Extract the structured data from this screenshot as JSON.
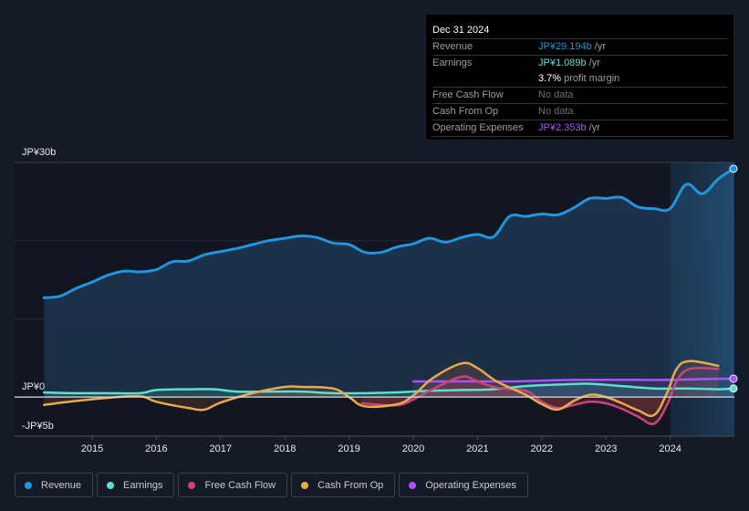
{
  "tooltip": {
    "date": "Dec 31 2024",
    "rows": [
      {
        "label": "Revenue",
        "value": "JP¥29.194b",
        "suffix": " /yr",
        "color": "#2394df"
      },
      {
        "label": "Earnings",
        "value": "JP¥1.089b",
        "suffix": " /yr",
        "color": "#5fe0cf"
      },
      {
        "label": "",
        "value": "3.7%",
        "suffix": " profit margin",
        "color": "#ffffff"
      },
      {
        "label": "Free Cash Flow",
        "value": "No data",
        "suffix": "",
        "color": "#6b6f76"
      },
      {
        "label": "Cash From Op",
        "value": "No data",
        "suffix": "",
        "color": "#6b6f76"
      },
      {
        "label": "Operating Expenses",
        "value": "JP¥2.353b",
        "suffix": " /yr",
        "color": "#a855f7"
      }
    ]
  },
  "legend": [
    {
      "label": "Revenue",
      "color": "#2394df"
    },
    {
      "label": "Earnings",
      "color": "#5fe0cf"
    },
    {
      "label": "Free Cash Flow",
      "color": "#c9457f"
    },
    {
      "label": "Cash From Op",
      "color": "#e9a94f"
    },
    {
      "label": "Operating Expenses",
      "color": "#a855f7"
    }
  ],
  "chart_data": {
    "type": "line",
    "title": "",
    "xlabel": "",
    "ylabel": "",
    "ylim": [
      -5,
      30
    ],
    "xlim": [
      2014.2,
      2024.99
    ],
    "y_tick_labels": [
      {
        "value": 30,
        "label": "JP¥30b"
      },
      {
        "value": 0,
        "label": "JP¥0"
      },
      {
        "value": -5,
        "label": "-JP¥5b"
      }
    ],
    "gridlines": [
      30,
      20,
      10,
      0
    ],
    "x_tick_labels": [
      "2015",
      "2016",
      "2017",
      "2018",
      "2019",
      "2020",
      "2021",
      "2022",
      "2023",
      "2024"
    ],
    "highlight_from": 2024.0,
    "units": "JPY billions",
    "series": [
      {
        "name": "Revenue",
        "color": "#2394df",
        "fill": true,
        "x": [
          2014.25,
          2014.5,
          2014.75,
          2015.0,
          2015.25,
          2015.5,
          2015.75,
          2016.0,
          2016.25,
          2016.5,
          2016.75,
          2017.0,
          2017.25,
          2017.5,
          2017.75,
          2018.0,
          2018.25,
          2018.5,
          2018.75,
          2019.0,
          2019.25,
          2019.5,
          2019.75,
          2020.0,
          2020.25,
          2020.5,
          2020.75,
          2021.0,
          2021.25,
          2021.5,
          2021.75,
          2022.0,
          2022.25,
          2022.5,
          2022.75,
          2023.0,
          2023.25,
          2023.5,
          2023.75,
          2024.0,
          2024.25,
          2024.5,
          2024.75,
          2024.99
        ],
        "values": [
          12.7,
          12.9,
          13.9,
          14.7,
          15.6,
          16.1,
          16.0,
          16.3,
          17.3,
          17.4,
          18.2,
          18.6,
          19.0,
          19.5,
          20.0,
          20.3,
          20.6,
          20.4,
          19.7,
          19.5,
          18.5,
          18.5,
          19.2,
          19.6,
          20.3,
          19.8,
          20.4,
          20.8,
          20.5,
          23.1,
          23.1,
          23.4,
          23.3,
          24.2,
          25.4,
          25.4,
          25.5,
          24.3,
          24.1,
          24.1,
          27.2,
          26.0,
          27.9,
          29.19
        ]
      },
      {
        "name": "Earnings",
        "color": "#5fe0cf",
        "fill": true,
        "x": [
          2014.25,
          2014.75,
          2015.25,
          2015.75,
          2016.0,
          2016.5,
          2016.9,
          2017.25,
          2017.75,
          2018.25,
          2018.75,
          2019.25,
          2019.75,
          2020.25,
          2020.75,
          2021.25,
          2021.75,
          2022.25,
          2022.75,
          2023.25,
          2023.75,
          2024.25,
          2024.75,
          2024.99
        ],
        "values": [
          0.6,
          0.5,
          0.5,
          0.5,
          0.9,
          1.0,
          1.0,
          0.7,
          0.7,
          0.7,
          0.5,
          0.5,
          0.6,
          0.8,
          0.9,
          1.0,
          1.4,
          1.6,
          1.7,
          1.4,
          1.1,
          1.1,
          1.0,
          1.09
        ]
      },
      {
        "name": "Free Cash Flow",
        "color": "#c9457f",
        "fill": true,
        "x": [
          2019.2,
          2019.5,
          2019.8,
          2020.0,
          2020.3,
          2020.75,
          2021.0,
          2021.3,
          2021.75,
          2022.0,
          2022.25,
          2022.5,
          2022.75,
          2023.0,
          2023.25,
          2023.5,
          2023.75,
          2023.95,
          2024.1,
          2024.3,
          2024.75
        ],
        "values": [
          -0.8,
          -1.0,
          -1.0,
          -0.3,
          1.0,
          2.6,
          2.0,
          1.2,
          0.8,
          -0.6,
          -1.4,
          -1.0,
          -0.6,
          -0.8,
          -1.5,
          -2.5,
          -3.4,
          -1.0,
          2.0,
          3.6,
          3.6
        ]
      },
      {
        "name": "Cash From Op",
        "color": "#e9a94f",
        "fill": true,
        "x": [
          2014.25,
          2014.75,
          2015.25,
          2015.75,
          2016.0,
          2016.5,
          2016.75,
          2017.0,
          2017.5,
          2018.0,
          2018.25,
          2018.75,
          2019.0,
          2019.25,
          2019.75,
          2020.0,
          2020.3,
          2020.75,
          2021.0,
          2021.3,
          2021.75,
          2022.0,
          2022.25,
          2022.5,
          2022.75,
          2023.0,
          2023.25,
          2023.5,
          2023.75,
          2023.95,
          2024.1,
          2024.3,
          2024.75
        ],
        "values": [
          -1.0,
          -0.5,
          -0.1,
          0.1,
          -0.6,
          -1.4,
          -1.6,
          -0.7,
          0.5,
          1.3,
          1.3,
          1.1,
          0.0,
          -1.2,
          -0.9,
          0.2,
          2.4,
          4.3,
          3.7,
          2.0,
          0.3,
          -0.9,
          -1.6,
          -0.5,
          0.3,
          0.0,
          -0.8,
          -1.7,
          -2.3,
          0.5,
          3.6,
          4.6,
          4.0
        ]
      },
      {
        "name": "Operating Expenses",
        "color": "#a855f7",
        "fill": true,
        "x": [
          2020.0,
          2020.5,
          2021.0,
          2021.5,
          2022.0,
          2022.5,
          2023.0,
          2023.5,
          2024.0,
          2024.5,
          2024.99
        ],
        "values": [
          2.0,
          2.0,
          2.0,
          2.0,
          2.1,
          2.2,
          2.2,
          2.2,
          2.2,
          2.3,
          2.35
        ]
      }
    ]
  }
}
